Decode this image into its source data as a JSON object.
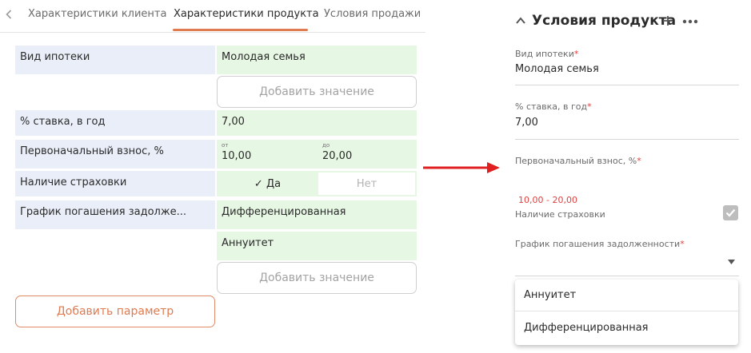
{
  "tabs": {
    "items": [
      {
        "label": "Характеристики клиента"
      },
      {
        "label": "Характеристики продукта"
      },
      {
        "label": "Условия продажи"
      }
    ],
    "active_index": 1
  },
  "params_table": {
    "rows": [
      {
        "label": "Вид ипотеки",
        "values": [
          "Молодая семья"
        ]
      },
      {
        "label": "% ставка, в год",
        "values": [
          "7,00"
        ]
      },
      {
        "label": "Первоначальный взнос, %",
        "range": {
          "from_label": "от",
          "from": "10,00",
          "to_label": "до",
          "to": "20,00"
        }
      },
      {
        "label": "Наличие страховки",
        "toggle": {
          "yes": "✓ Да",
          "no": "Нет",
          "selected": "yes"
        }
      },
      {
        "label": "График погашения задолже...",
        "values": [
          "Дифференцированная",
          "Аннуитет"
        ]
      }
    ],
    "add_value_label": "Добавить значение",
    "add_param_label": "Добавить параметр"
  },
  "product_conditions": {
    "title": "Условия продукта",
    "fields": {
      "mortgage_type": {
        "label": "Вид ипотеки",
        "value": "Молодая семья"
      },
      "rate": {
        "label": "% ставка, в год",
        "value": "7,00"
      },
      "down_payment": {
        "label": "Первоначальный взнос, %",
        "value": "",
        "hint": "10,00 - 20,00"
      },
      "insurance": {
        "label": "Наличие страховки",
        "checked": true
      },
      "schedule": {
        "label": "График погашения задолженности",
        "value": ""
      }
    },
    "required_mark": "*",
    "dropdown_options": [
      "Аннуитет",
      "Дифференцированная"
    ]
  },
  "colors": {
    "accent": "#e07a50",
    "label_bg": "#e9eef8",
    "value_bg": "#e6f7e3",
    "arrow": "#e02020",
    "error": "#e04040"
  }
}
